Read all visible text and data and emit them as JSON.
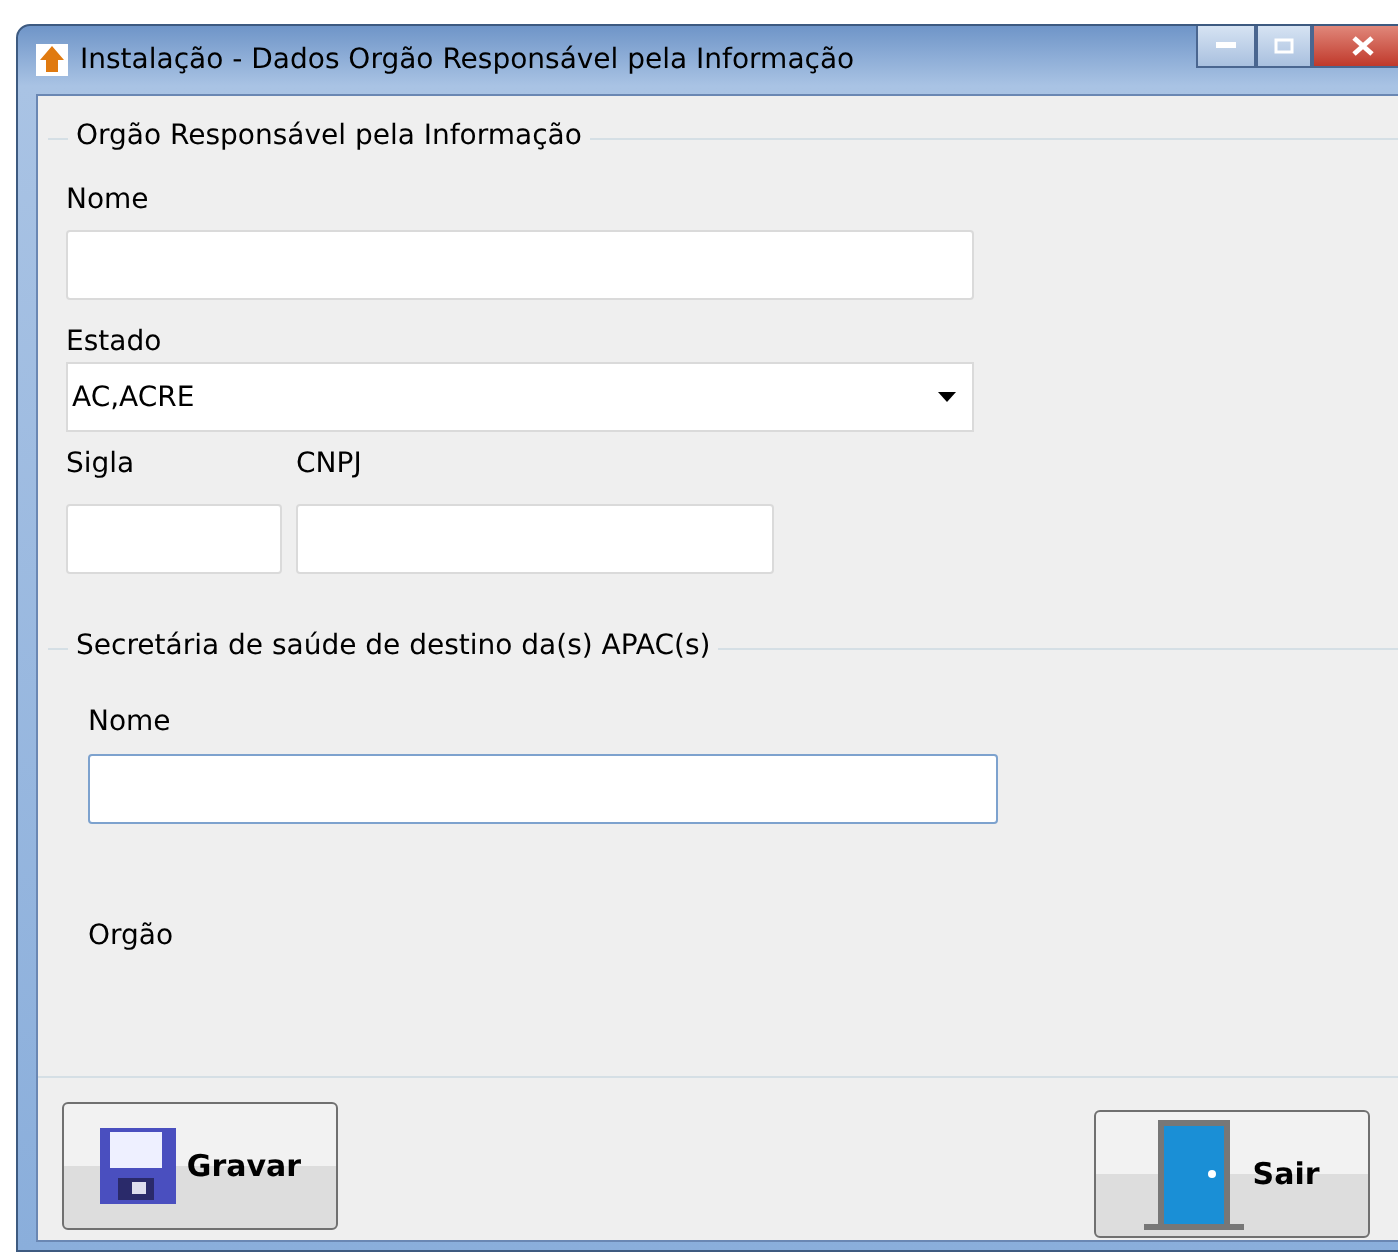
{
  "window": {
    "title": "Instalação - Dados Orgão Responsável pela Informação"
  },
  "orgao_group": {
    "title": "Orgão Responsável pela Informação",
    "nome_label": "Nome",
    "estado_label": "Estado",
    "estado_value": "AC,ACRE",
    "sigla_label": "Sigla",
    "cnpj_label": "CNPJ"
  },
  "secretaria_group": {
    "title": "Secretária de saúde de destino da(s) APAC(s)",
    "nome_label": "Nome",
    "orgao_label": "Orgão"
  },
  "buttons": [
    {
      "kind": "save",
      "label": "Gravar"
    },
    {
      "kind": "exit",
      "label": "Sair"
    }
  ]
}
